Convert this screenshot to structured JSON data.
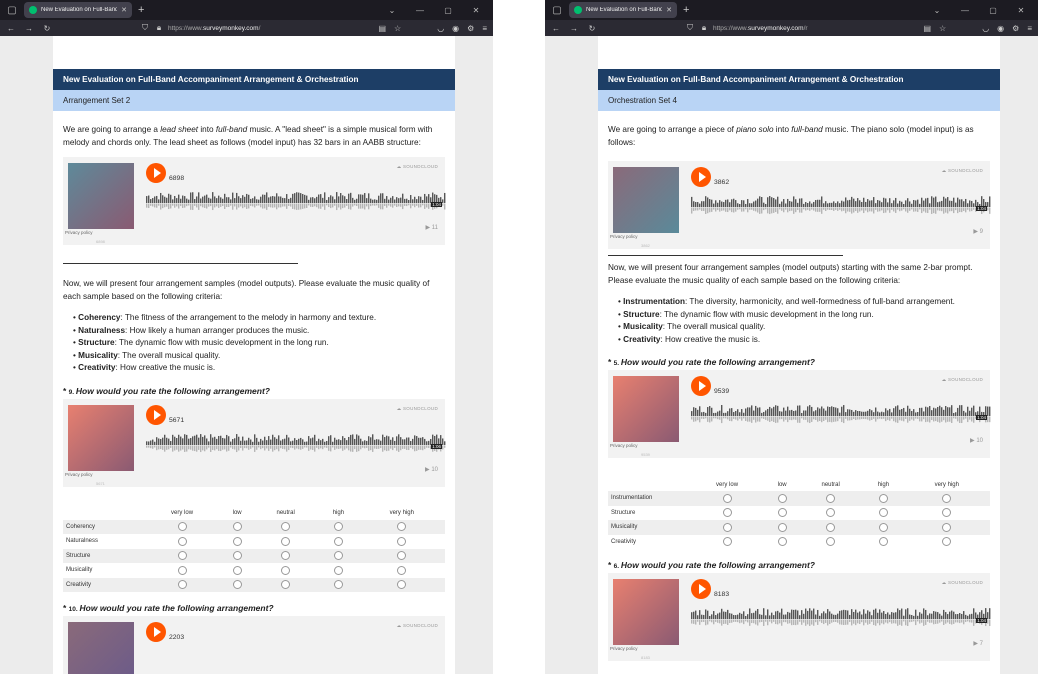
{
  "browser": {
    "tab_title": "New Evaluation on Full-Band A",
    "url_prefix": "https://www.",
    "url_domain": "surveymonkey.com",
    "url_suffix_left": "/",
    "url_suffix_right": "/r"
  },
  "left": {
    "header": "New Evaluation on Full-Band Accompaniment Arrangement & Orchestration",
    "section": "Arrangement Set 2",
    "intro": {
      "p1": "We are going to arrange a ",
      "em1": "lead sheet",
      "p2": " into ",
      "em2": "full-band",
      "p3": " music. A \"lead sheet\" is a simple musical form with melody and chords only. The lead sheet as follows (model input) has 32 bars in an AABB structure:"
    },
    "player_input": {
      "count": "6898",
      "time": "1:04",
      "plays": "▶ 11",
      "sub": "6898"
    },
    "body": "Now, we will present four arrangement samples (model outputs). Please evaluate the music quality of each sample based on the following criteria:",
    "criteria": [
      {
        "name": "Coherency",
        "desc": ": The fitness of the arrangement to the melody in harmony and texture."
      },
      {
        "name": "Naturalness",
        "desc": ": How likely a human arranger produces the music."
      },
      {
        "name": "Structure",
        "desc": ": The dynamic flow with music development in the long run."
      },
      {
        "name": "Musicality",
        "desc": ": The overall musical quality."
      },
      {
        "name": "Creativity",
        "desc": ": How creative the music is."
      }
    ],
    "q9": {
      "star": "* ",
      "num": "9. ",
      "text": "How would you rate the following arrangement?"
    },
    "player_q9": {
      "count": "5671",
      "time": "1:06",
      "plays": "▶ 10",
      "sub": "5671"
    },
    "matrix_rows": [
      "Coherency",
      "Naturalness",
      "Structure",
      "Musicality",
      "Creativity"
    ],
    "q10": {
      "star": "* ",
      "num": "10. ",
      "text": "How would you rate the following arrangement?"
    },
    "player_q10": {
      "count": "2203"
    }
  },
  "right": {
    "header": "New Evaluation on Full-Band Accompaniment Arrangement & Orchestration",
    "section": "Orchestration Set 4",
    "intro": {
      "p1": "We are going to arrange a piece of ",
      "em1": "piano solo",
      "p2": " into ",
      "em2": "full-band",
      "p3": " music. The piano solo (model input) is as follows:"
    },
    "player_input": {
      "count": "3862",
      "time": "1:04",
      "plays": "▶ 9",
      "sub": "3862"
    },
    "body": "Now, we will present four arrangement samples (model outputs) starting with the same 2-bar prompt. Please evaluate the music quality of each sample based on the following criteria:",
    "criteria": [
      {
        "name": "Instrumentation",
        "desc": ": The diversity, harmonicity, and well-formedness of full-band arrangement."
      },
      {
        "name": "Structure",
        "desc": ": The dynamic flow with music development in the long run."
      },
      {
        "name": "Musicality",
        "desc": ": The overall musical quality."
      },
      {
        "name": "Creativity",
        "desc": ": How creative the music is."
      }
    ],
    "q5": {
      "star": "* ",
      "num": "5. ",
      "text": "How would you rate the following arrangement?"
    },
    "player_q5": {
      "count": "9539",
      "time": "1:04",
      "plays": "▶ 10",
      "sub": "9539"
    },
    "matrix_rows": [
      "Instrumentation",
      "Structure",
      "Musicality",
      "Creativity"
    ],
    "q6": {
      "star": "* ",
      "num": "6. ",
      "text": "How would you rate the following arrangement?"
    },
    "player_q6": {
      "count": "8183",
      "time": "1:04",
      "plays": "▶ 7",
      "sub": "8183"
    }
  },
  "scale": [
    "very low",
    "low",
    "neutral",
    "high",
    "very high"
  ],
  "soundcloud": {
    "logo": "☁ SOUNDCLOUD",
    "privacy": "Privacy policy"
  },
  "colors": {
    "header_bg": "#1d3e66",
    "section_bg": "#b9d4f5",
    "play_button": "#ff5500",
    "art_input_left": [
      "#5e8a9a",
      "#8a5a72"
    ],
    "art_input_right": [
      "#8a6a7a",
      "#5a8a9a"
    ],
    "art_sample": [
      "#e88070",
      "#8a5a72"
    ]
  }
}
